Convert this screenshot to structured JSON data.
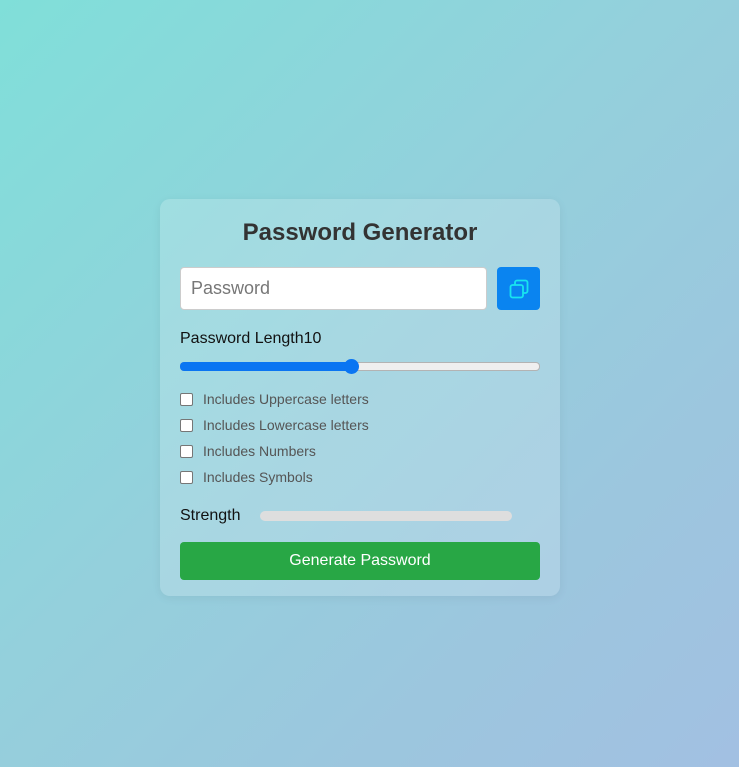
{
  "card": {
    "title": "Password Generator"
  },
  "password": {
    "value": "",
    "placeholder": "Password"
  },
  "copy_button": {
    "icon": "copy-icon",
    "color": "#0a84f0"
  },
  "length": {
    "label": "Password Length",
    "value": "10",
    "min": 1,
    "max": 20,
    "current": 10
  },
  "options": [
    {
      "label": "Includes Uppercase letters",
      "checked": false
    },
    {
      "label": "Includes Lowercase letters",
      "checked": false
    },
    {
      "label": "Includes Numbers",
      "checked": false
    },
    {
      "label": "Includes Symbols",
      "checked": false
    }
  ],
  "strength": {
    "label": "Strength",
    "level": 0
  },
  "generate_button": {
    "label": "Generate Password",
    "color": "#28a745"
  }
}
